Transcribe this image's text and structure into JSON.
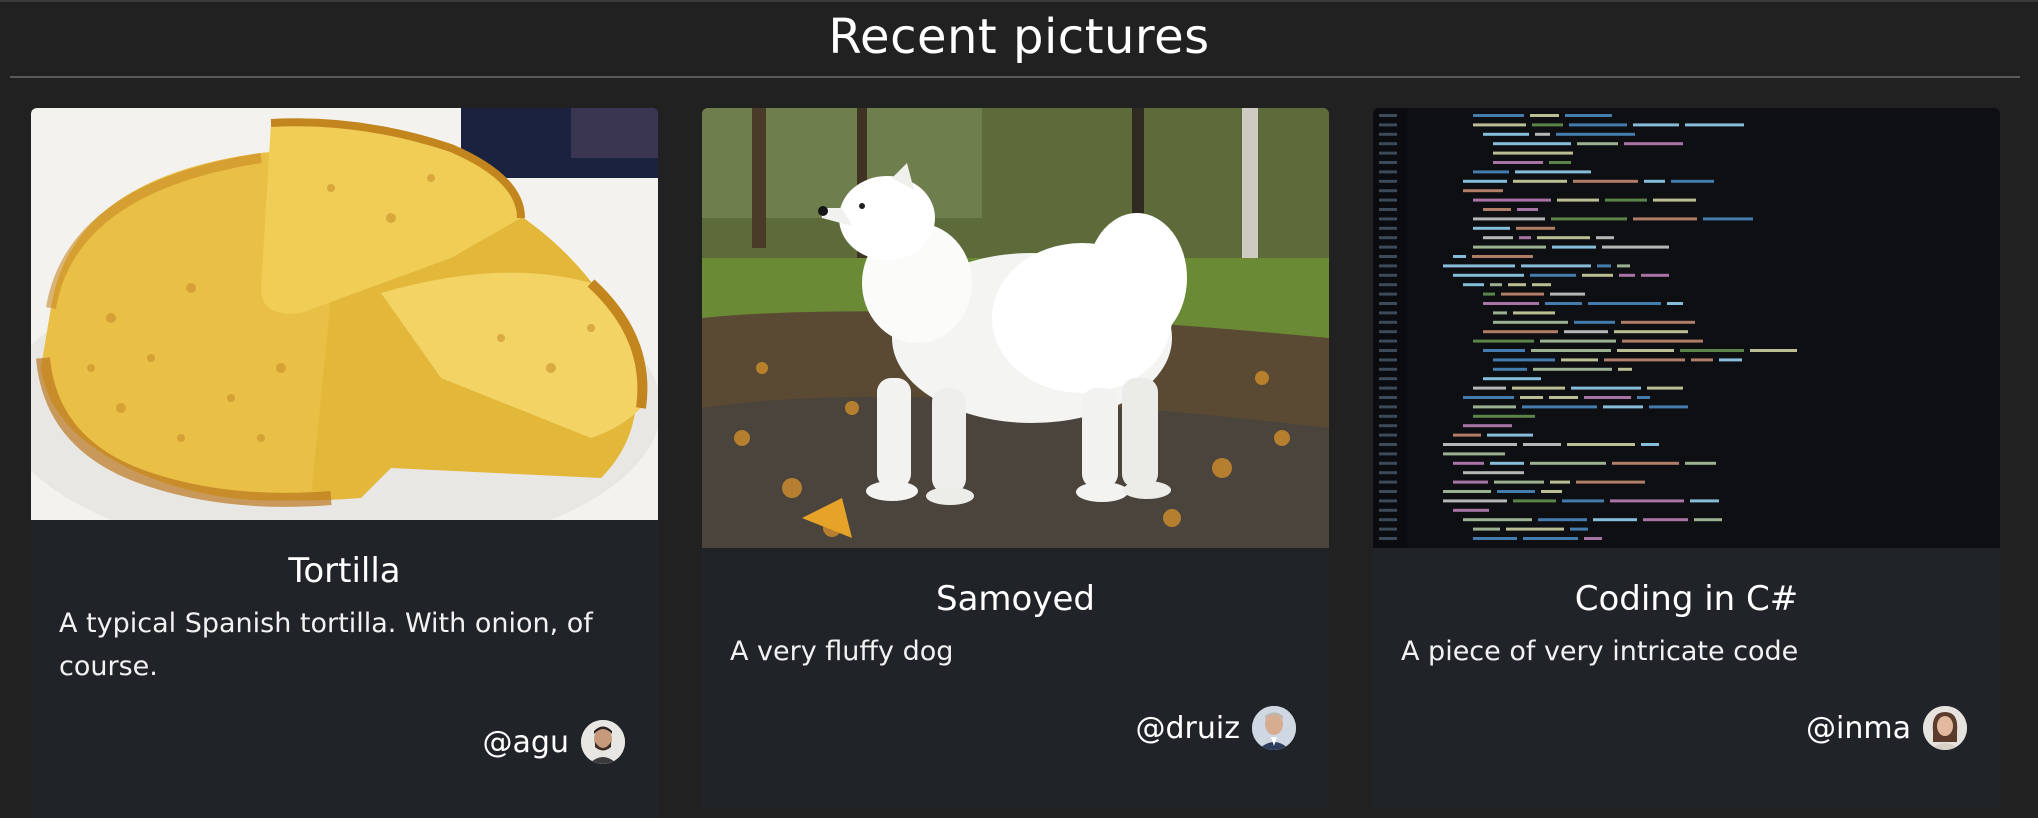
{
  "page": {
    "title": "Recent pictures"
  },
  "cards": [
    {
      "title": "Tortilla",
      "description": "A typical Spanish tortilla. With onion, of course.",
      "author": "@agu",
      "image": "tortilla-photo"
    },
    {
      "title": "Samoyed",
      "description": "A very fluffy dog",
      "author": "@druiz",
      "image": "samoyed-photo"
    },
    {
      "title": "Coding in C#",
      "description": "A piece of very intricate code",
      "author": "@inma",
      "image": "code-screenshot"
    }
  ],
  "colors": {
    "background": "#212121",
    "card": "#202429",
    "divider": "#5a5a5a",
    "text": "#ffffff"
  }
}
